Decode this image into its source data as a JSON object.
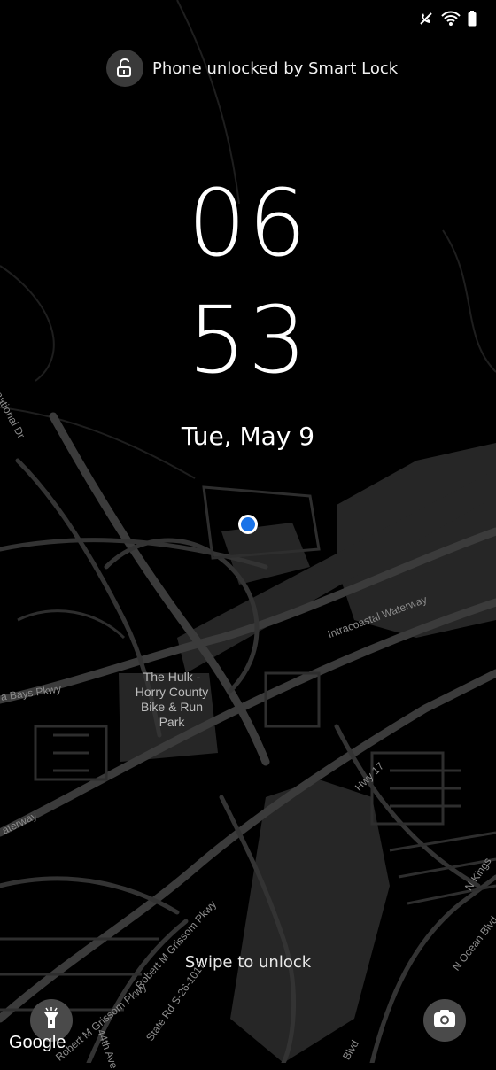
{
  "status_bar": {
    "icons": [
      "wifi-calling-off-icon",
      "wifi-icon",
      "battery-icon"
    ]
  },
  "smart_lock": {
    "icon": "unlock-icon",
    "text": "Phone unlocked by Smart Lock"
  },
  "clock": {
    "hour": "06",
    "minute": "53"
  },
  "date": "Tue, May 9",
  "map": {
    "place_label": "The Hulk - Horry County Bike & Run Park",
    "road_labels": {
      "intracoastal": "Intracoastal Waterway",
      "hwy17": "Hwy 17",
      "bays_pkwy": "a Bays Pkwy",
      "international_dr": "rnational Dr",
      "waterway_left": "aterway",
      "grissom_1": "Robert M Grissom Pkwy",
      "grissom_2": "Robert M Grissom Pkwy",
      "state_rd": "State Rd S-26-1017",
      "ave_44": "44th Ave",
      "kings": "N Kings",
      "ocean_blvd": "N Ocean Blvd",
      "blvd": "Blvd"
    },
    "attribution": "Google"
  },
  "swipe_hint": "Swipe to unlock",
  "shortcuts": {
    "left": "flashlight-icon",
    "right": "camera-icon"
  },
  "colors": {
    "background": "#000000",
    "map_road": "#3a3a3a",
    "map_area": "#2c2c2c",
    "location_dot": "#1a73e8"
  }
}
